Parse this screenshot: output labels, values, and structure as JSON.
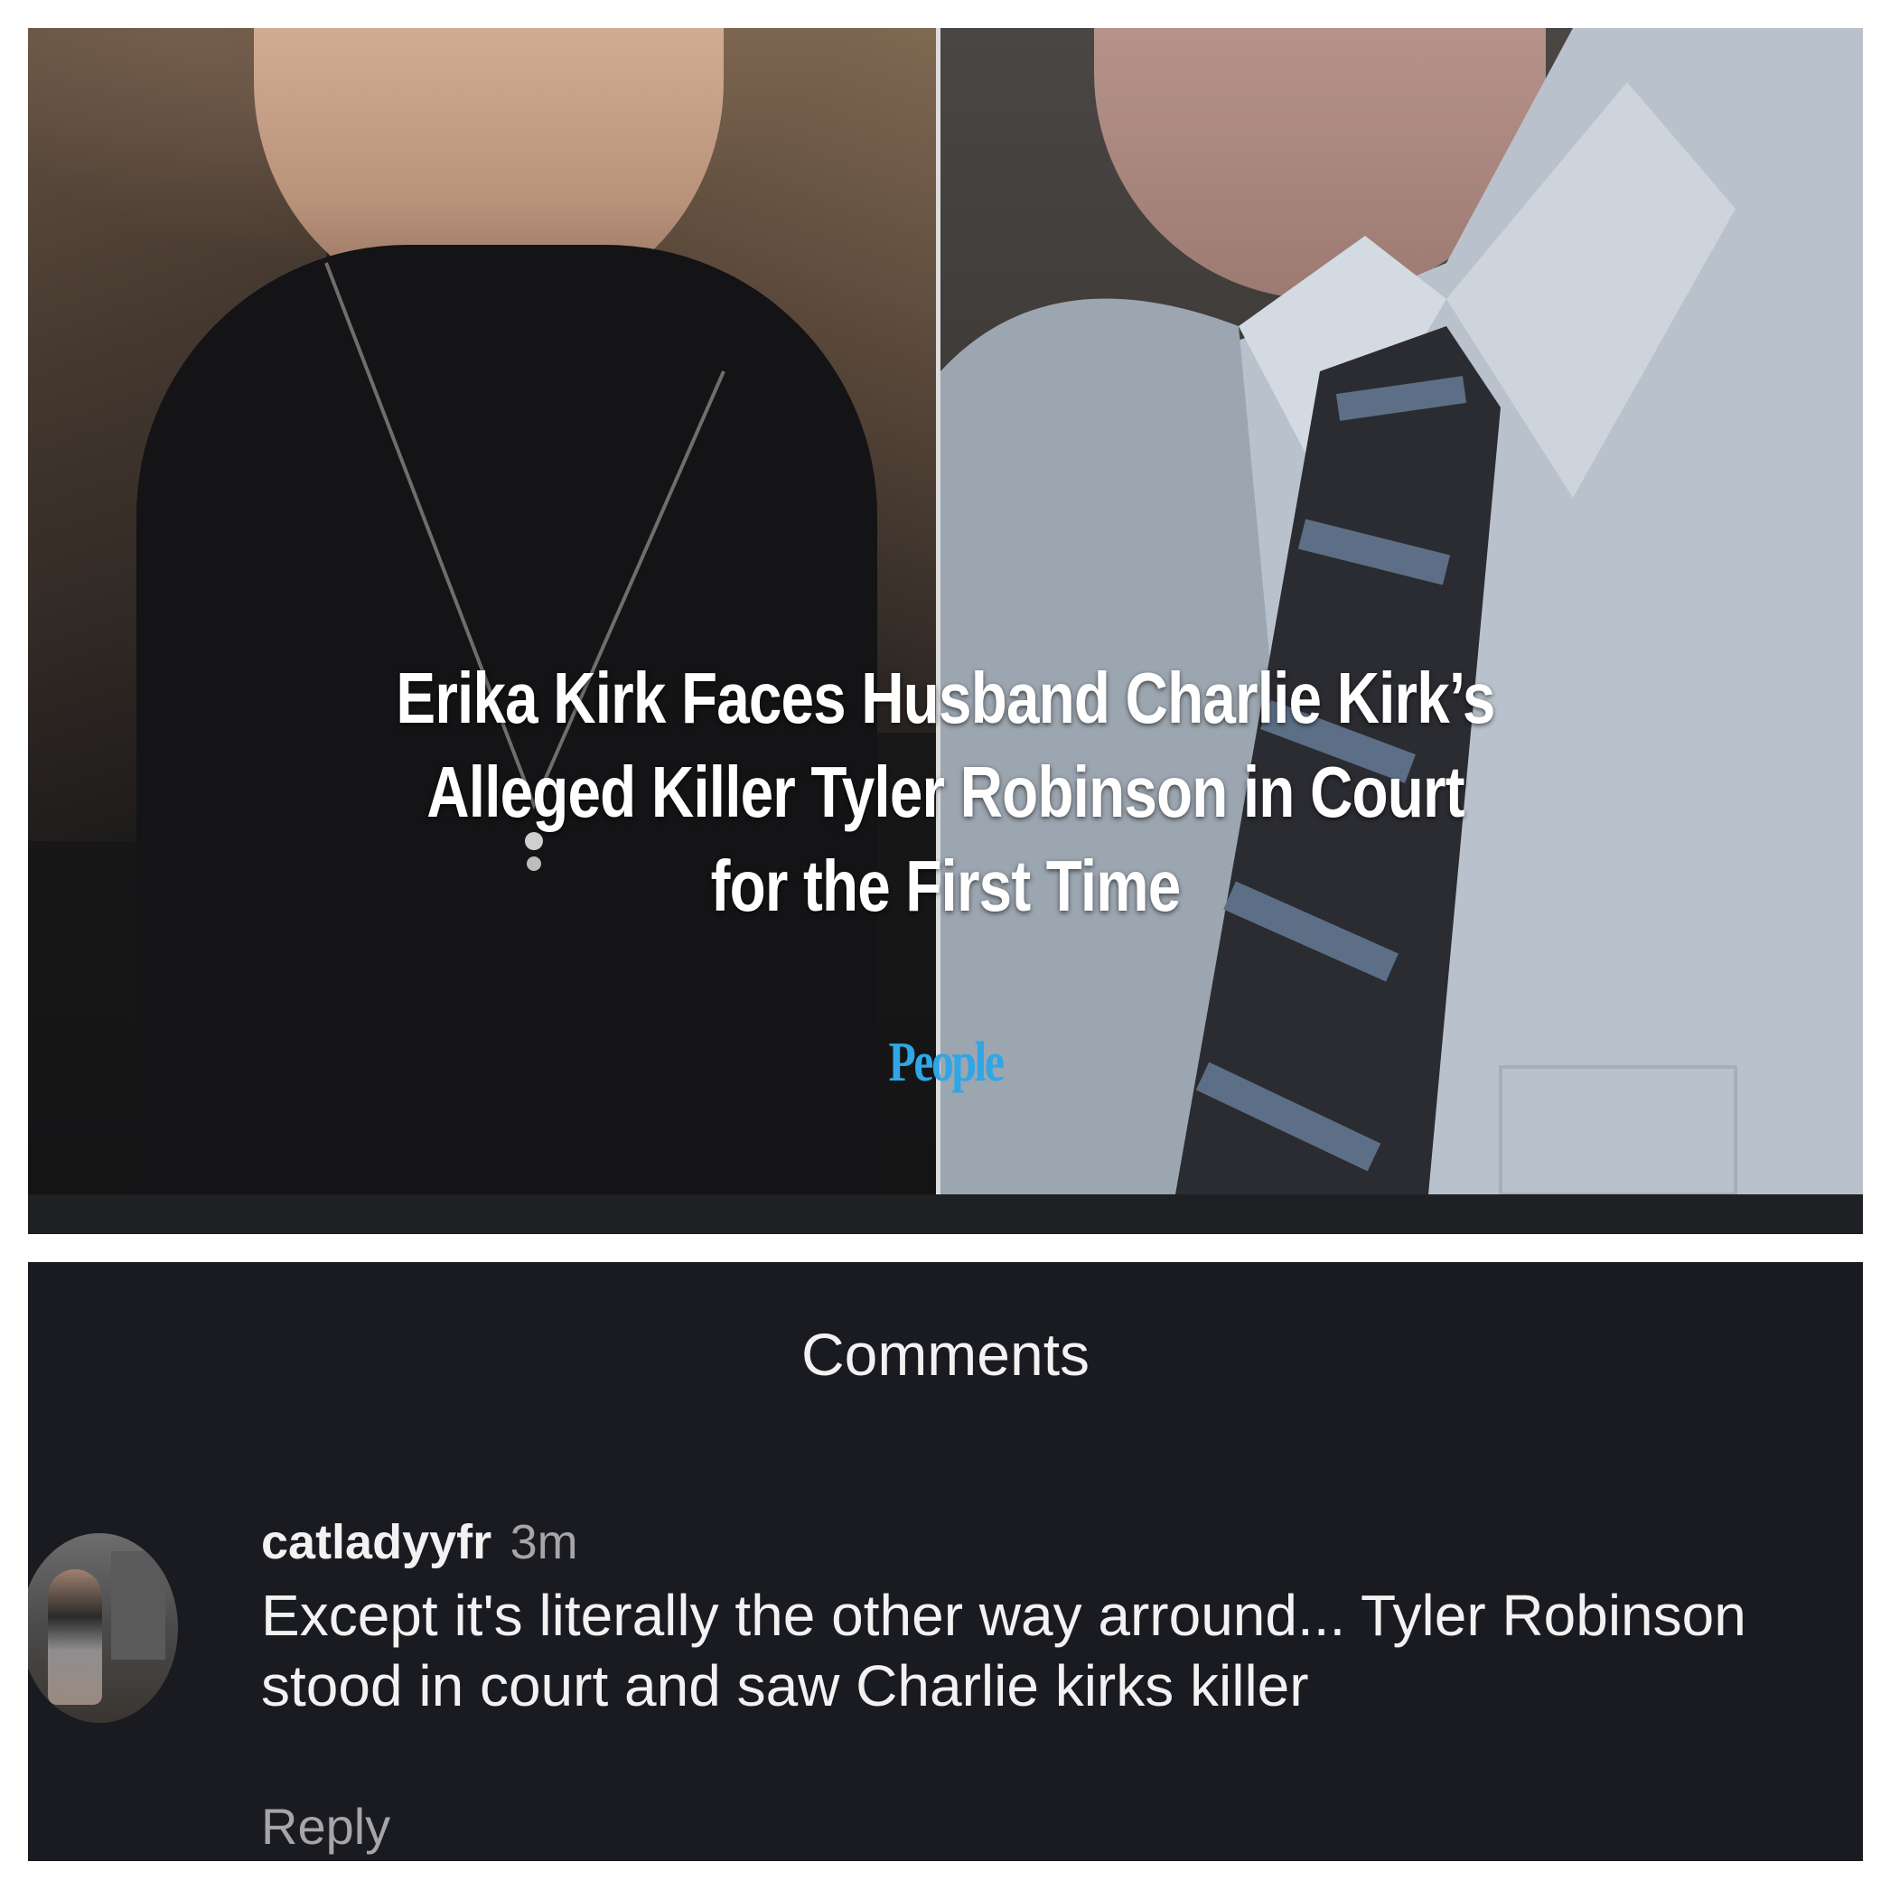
{
  "post": {
    "headline_lines": [
      "Erika Kirk Faces Husband Charlie Kirk’s",
      "Alleged Killer Tyler Robinson in Court",
      "for the First Time"
    ],
    "source_logo": "People",
    "colors": {
      "headline": "#ffffff",
      "logo": "#2fa6e6"
    }
  },
  "comments": {
    "title": "Comments",
    "items": [
      {
        "username": "catladyyfr",
        "time": "3m",
        "text": "Except it's literally the other way arround... Tyler Robinson stood in court and saw Charlie kirks killer",
        "reply_label": "Reply"
      }
    ],
    "colors": {
      "background": "#1a1b20",
      "primary_text": "#f2f2f2",
      "secondary_text": "#a6a6a8"
    }
  }
}
